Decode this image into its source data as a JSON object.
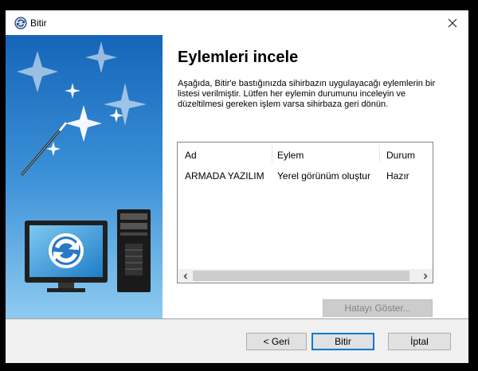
{
  "window": {
    "title": "Bitir"
  },
  "page": {
    "heading": "Eylemleri incele",
    "description": "Aşağıda, Bitir'e bastığınızda sihirbazın uygulayacağı eylemlerin bir listesi verilmiştir. Lütfen her eylemin durumunu inceleyin ve düzeltilmesi gereken işlem varsa sihirbaza geri dönün."
  },
  "list": {
    "columns": [
      "Ad",
      "Eylem",
      "Durum"
    ],
    "rows": [
      [
        "ARMADA YAZILIM",
        "Yerel görünüm oluştur",
        "Hazır"
      ]
    ]
  },
  "buttons": {
    "show_error": "Hatayı Göster...",
    "back": "< Geri",
    "finish": "Bitir",
    "cancel": "İptal"
  },
  "colors": {
    "accent": "#0078d7",
    "side_top": "#1565b8",
    "side_bottom": "#8ecbf0"
  }
}
